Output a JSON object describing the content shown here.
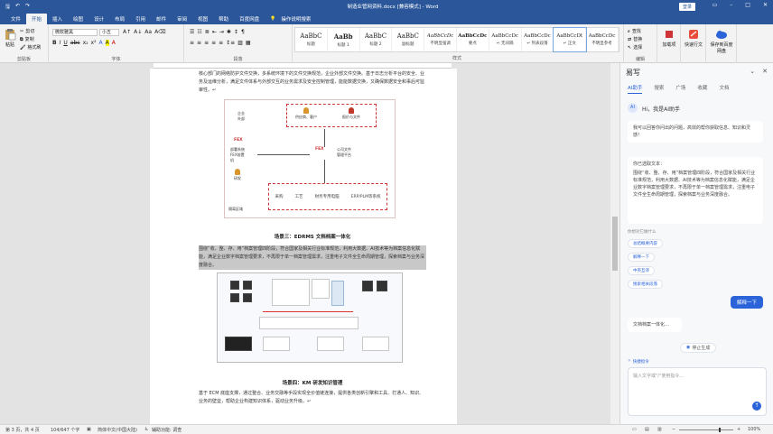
{
  "window": {
    "title": "制造业管网资料.docx [兼容模式] - Word",
    "login_label": "登录",
    "qat_icons": [
      "save-icon",
      "undo-icon",
      "redo-icon"
    ]
  },
  "tabs": {
    "items": [
      "文件",
      "开始",
      "插入",
      "绘图",
      "设计",
      "布局",
      "引用",
      "邮件",
      "审阅",
      "视图",
      "帮助",
      "百度网盘"
    ],
    "active": "开始",
    "tell_me": "操作说明搜索"
  },
  "ribbon": {
    "clipboard": {
      "paste": "粘贴",
      "cut": "剪切",
      "copy": "复制",
      "format_painter": "格式刷",
      "label": "剪贴板"
    },
    "font": {
      "name": "微软雅黑",
      "size": "小五",
      "label": "字体",
      "tools": [
        "B",
        "I",
        "U",
        "abc",
        "x₂",
        "x²",
        "A",
        "A",
        "A"
      ]
    },
    "paragraph": {
      "label": "段落"
    },
    "styles": {
      "label": "样式",
      "items": [
        {
          "preview": "AaBbC",
          "name": "标题"
        },
        {
          "preview": "AaBb",
          "name": "标题 1"
        },
        {
          "preview": "AaBbC",
          "name": "标题 2"
        },
        {
          "preview": "AaBbC",
          "name": "副标题"
        },
        {
          "preview": "AaBbCcDc",
          "name": "不明显强调"
        },
        {
          "preview": "AaBbCcDc",
          "name": "要点"
        },
        {
          "preview": "AaBbCcDc",
          "name": "↵ 无间隔"
        },
        {
          "preview": "AaBbCcDc",
          "name": "↵ 列表段落"
        },
        {
          "preview": "AaBbCcDt",
          "name": "↵ 正文"
        },
        {
          "preview": "AaBbCcDc",
          "name": "不明显参考"
        },
        {
          "preview": "AaBbCcDc",
          "name": "明显强调"
        }
      ]
    },
    "editing": {
      "find": "查找",
      "replace": "替换",
      "select": "选择",
      "label": "编辑"
    },
    "extra": [
      {
        "label": "加载项"
      },
      {
        "label": "快速行文"
      },
      {
        "label": "保存到百度网盘"
      }
    ]
  },
  "document": {
    "para1": "核心部门的网络防护文件交换，多系统环境下的文件交换规范，企业外部文件交换。基于日志分析平台的安全、业务及运维分析，满足文件体系与外部交互的业务需求及安全控制管理，能能数据交换，又确保数据安全和事后可监审性。↵",
    "fig1": {
      "outside": "企业\n外部",
      "inside": "研发",
      "isolation": "隔离区域",
      "fex": "FEX",
      "supplier": "供应商、客户",
      "notes": "报价与文件",
      "nodes": [
        "采购",
        "工艺",
        "财务专用电脑",
        "ERP/PLM等系统"
      ],
      "side_left": "部署系统\nFEX前置\n机",
      "side_right": "公司文件\n管理平台"
    },
    "caption3": "场景三：EDRMS 文档档案一体化",
    "para2": "围绕“收、整、存、用”档案管理四阶段，符合国家及相关行业标准规范，利用大数据、AI技术等为档案信息化赋能，满足企业数字档案管理要求，不再限于单一档案管理需求，注重电子文件全生命周期管理，探索档案与业务深度融合。",
    "caption4": "场景四：KM 研发知识管理",
    "para3": "基于 ECM 底座支撑，通过整合、业务交融等手段实现全价值链连接，提供各类创新引擎和工具、打通人、知识、业务的壁垒，帮助企业构建知识体系，驱动业务升级。↵"
  },
  "ai_panel": {
    "title": "易写",
    "tabs": [
      "AI助手",
      "搜索",
      "广场",
      "收藏",
      "文档"
    ],
    "active_tab": "AI助手",
    "greeting": "Hi，我是AI助手",
    "intro": "我可以回答你问出的问题，高效的帮你获取信息、知识和灵感！",
    "selected_label": "你已选取文本：",
    "selected_text": "围绕“收、整、存、用”档案管理四阶段，符合国家及相关行业标准规范，利用大数据、AI技术等为档案信息化赋能，满足企业数字档案管理要求，不再限于单一档案管理需求，注重电子文件全生命周期管理，探索档案与业务深度融合。",
    "prompt_label": "你想对它做什么",
    "chips": [
      "总结概要内容",
      "解释一下",
      "中英互译",
      "搜索相关段落"
    ],
    "user_msg": "解释一下",
    "reply": "文档档案一体化…",
    "stop_label": "停止生成",
    "quick_label": "快捷指令",
    "input_placeholder": "输入文字或\"/\"使用指令…"
  },
  "status": {
    "page": "第 3 页，共 4 页",
    "words": "104/647 个字",
    "lang": "简体中文(中国大陆)",
    "access": "辅助功能: 调查",
    "zoom": "100%"
  }
}
